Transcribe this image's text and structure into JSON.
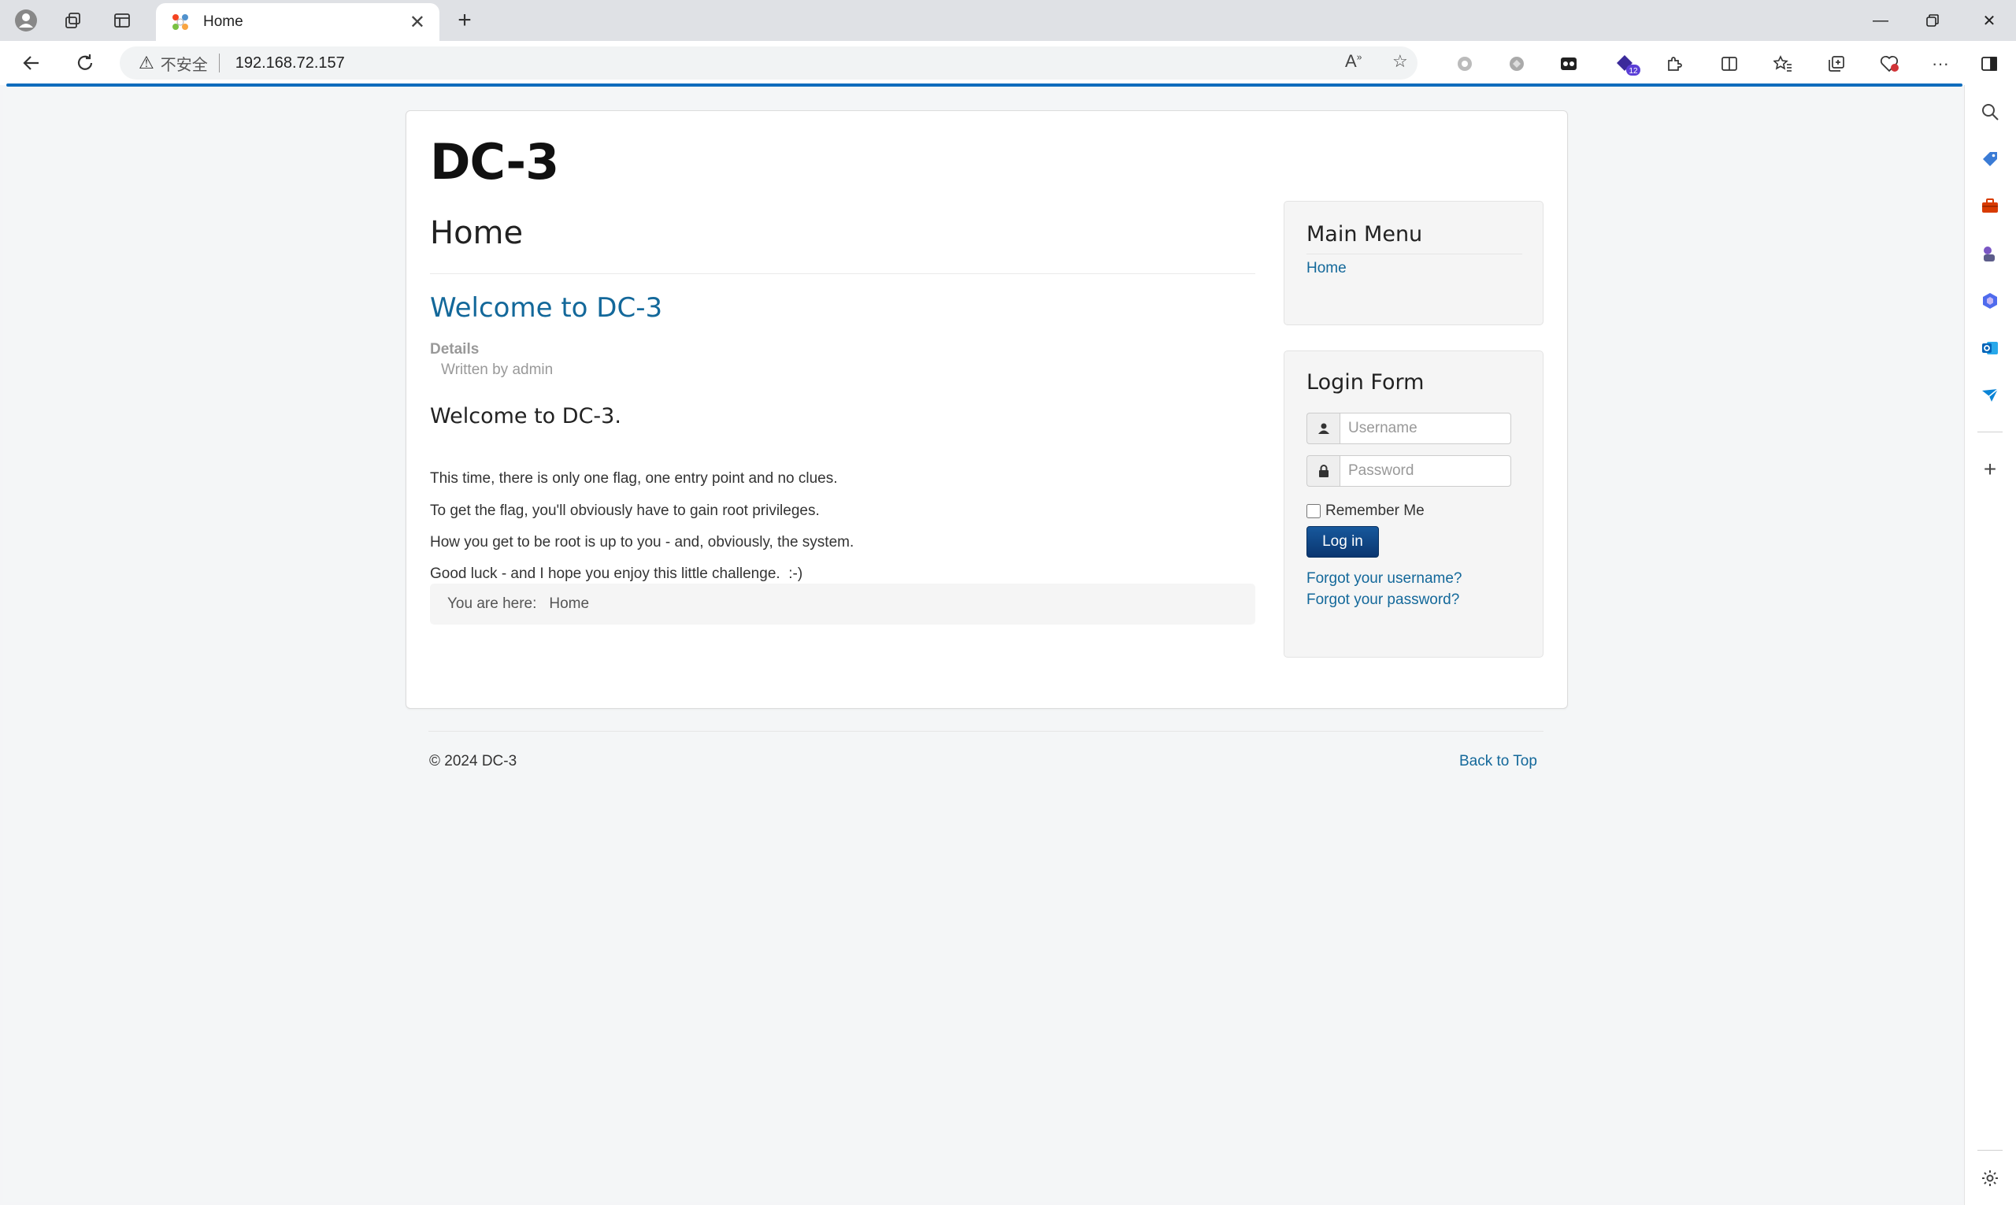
{
  "browser": {
    "tab_title": "Home",
    "security_label": "不安全",
    "url": "192.168.72.157",
    "extension_badge": "12"
  },
  "site": {
    "brand": "DC-3",
    "page_title": "Home",
    "article": {
      "title": "Welcome to DC-3",
      "details_label": "Details",
      "written_by": "Written by admin",
      "heading": "Welcome to DC-3.",
      "paragraphs": [
        "This time, there is only one flag, one entry point and no clues.",
        "To get the flag, you'll obviously have to gain root privileges.",
        "How you get to be root is up to you - and, obviously, the system.",
        "Good luck - and I hope you enjoy this little challenge.  :-)"
      ]
    },
    "breadcrumb": {
      "label": "You are here:",
      "current": "Home"
    },
    "main_menu": {
      "title": "Main Menu",
      "items": [
        "Home"
      ]
    },
    "login_form": {
      "title": "Login Form",
      "username_placeholder": "Username",
      "password_placeholder": "Password",
      "remember_label": "Remember Me",
      "login_button": "Log in",
      "forgot_username": "Forgot your username?",
      "forgot_password": "Forgot your password?"
    },
    "footer": {
      "copyright": "© 2024 DC-3",
      "back_to_top": "Back to Top"
    }
  },
  "colors": {
    "link": "#13689a",
    "accent": "#0f6cbd",
    "login_button": "#0a3670"
  }
}
